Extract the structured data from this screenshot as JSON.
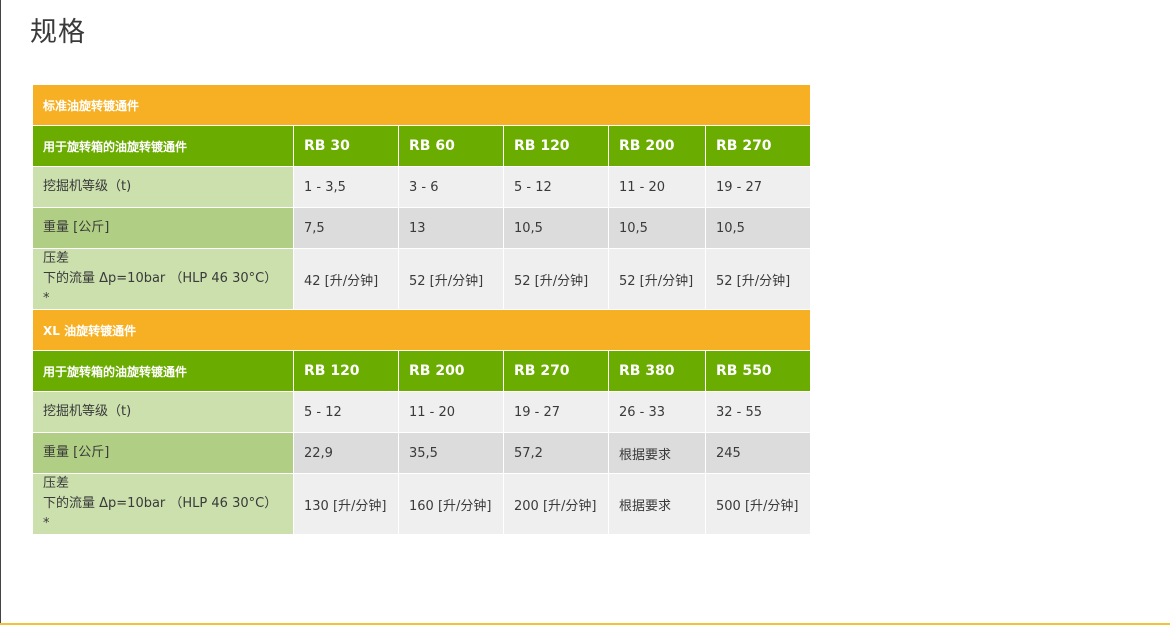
{
  "page_title": "规格",
  "sections": [
    {
      "title": "标准油旋转镀通件",
      "header_label": "用于旋转箱的油旋转镀通件",
      "models": [
        "RB 30",
        "RB 60",
        "RB 120",
        "RB 200",
        "RB 270"
      ],
      "rows": [
        {
          "label": "挖掘机等级（t)",
          "values": [
            "1 - 3,5",
            "3 - 6",
            "5 - 12",
            "11 - 20",
            "19 - 27"
          ]
        },
        {
          "label": "重量 [公斤]",
          "values": [
            "7,5",
            "13",
            "10,5",
            "10,5",
            "10,5"
          ]
        },
        {
          "label_line1": "压差",
          "label_line2": "下的流量 Δp=10bar （HLP 46 30°C）*",
          "values": [
            "42 [升/分钟]",
            "52 [升/分钟]",
            "52 [升/分钟]",
            "52 [升/分钟]",
            "52 [升/分钟]"
          ]
        }
      ]
    },
    {
      "title": "XL 油旋转镀通件",
      "header_label": "用于旋转箱的油旋转镀通件",
      "models": [
        "RB 120",
        "RB 200",
        "RB 270",
        "RB 380",
        "RB 550"
      ],
      "rows": [
        {
          "label": "挖掘机等级（t)",
          "values": [
            "5 - 12",
            "11 - 20",
            "19 - 27",
            "26 - 33",
            "32 - 55"
          ]
        },
        {
          "label": "重量 [公斤]",
          "values": [
            "22,9",
            "35,5",
            "57,2",
            "根据要求",
            "245"
          ]
        },
        {
          "label_line1": "压差",
          "label_line2": "下的流量 Δp=10bar （HLP 46 30°C）*",
          "values": [
            "130 [升/分钟]",
            "160 [升/分钟]",
            "200 [升/分钟]",
            "根据要求",
            "500 [升/分钟]"
          ]
        }
      ]
    }
  ]
}
